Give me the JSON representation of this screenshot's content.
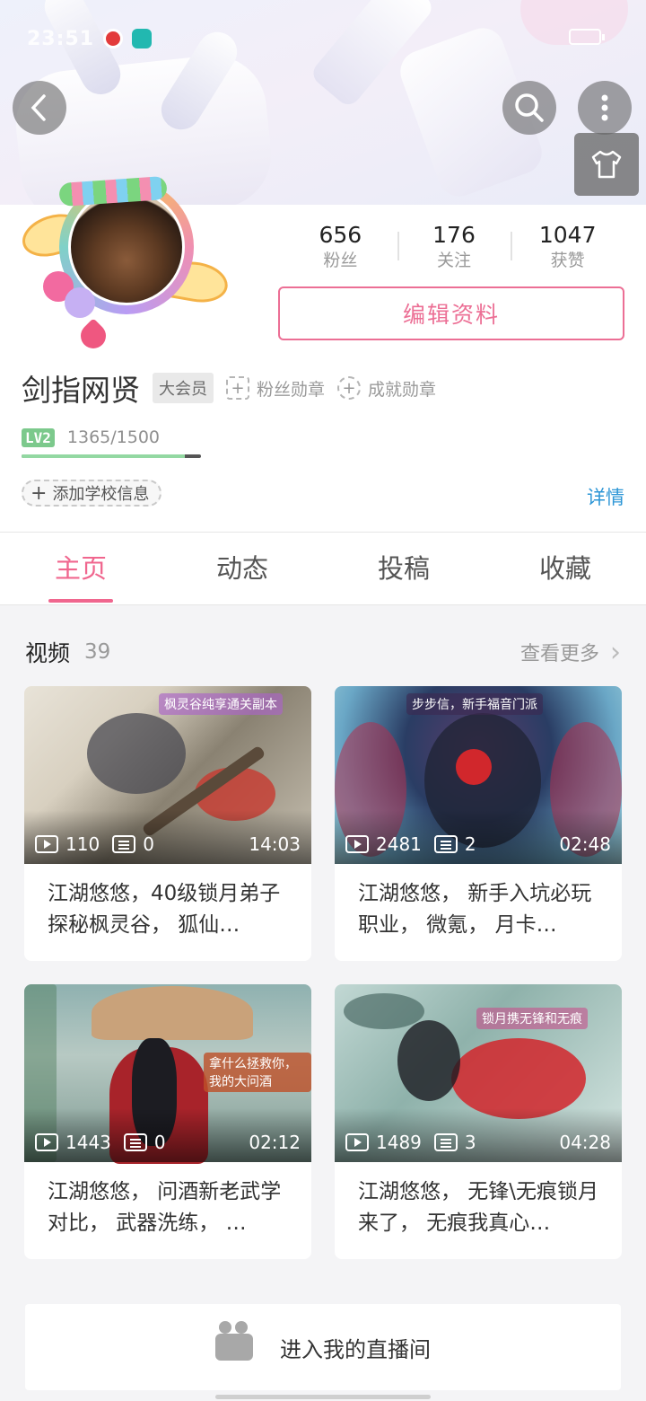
{
  "status_bar": {
    "time": "23:51"
  },
  "profile": {
    "stats": [
      {
        "value": "656",
        "label": "粉丝"
      },
      {
        "value": "176",
        "label": "关注"
      },
      {
        "value": "1047",
        "label": "获赞"
      }
    ],
    "edit_label": "编辑资料",
    "username": "剑指网贤",
    "vip_badge": "大会员",
    "fan_medal": "粉丝勋章",
    "achievement_medal": "成就勋章",
    "level_badge": "LV2",
    "exp_text": "1365/1500",
    "exp_fraction": 0.91,
    "add_school": "添加学校信息",
    "detail_link": "详情"
  },
  "tabs": [
    "主页",
    "动态",
    "投稿",
    "收藏"
  ],
  "videos_section": {
    "title": "视频",
    "count": "39",
    "see_more": "查看更多"
  },
  "videos": [
    {
      "plays": "110",
      "danmaku": "0",
      "duration": "14:03",
      "title": "江湖悠悠，40级锁月弟子探秘枫灵谷， 狐仙…",
      "tag": "枫灵谷纯享通关副本"
    },
    {
      "plays": "2481",
      "danmaku": "2",
      "duration": "02:48",
      "title": "江湖悠悠， 新手入坑必玩职业， 微氪， 月卡…",
      "tag": "步步信，新手福音门派"
    },
    {
      "plays": "1443",
      "danmaku": "0",
      "duration": "02:12",
      "title": "江湖悠悠， 问酒新老武学对比， 武器洗练， …",
      "tag": "拿什么拯救你，我的大问酒"
    },
    {
      "plays": "1489",
      "danmaku": "3",
      "duration": "04:28",
      "title": "江湖悠悠， 无锋\\无痕锁月来了， 无痕我真心…",
      "tag": "锁月携无锋和无痕"
    }
  ],
  "live_room": "进入我的直播间"
}
